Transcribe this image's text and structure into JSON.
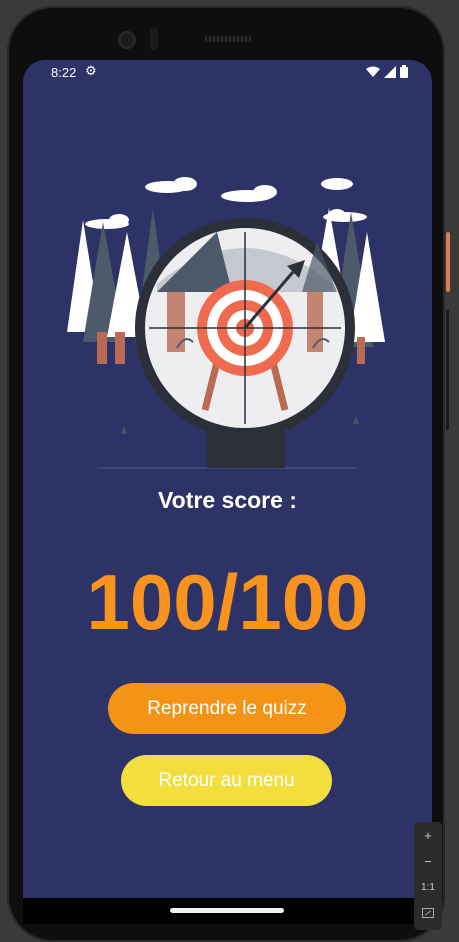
{
  "status_bar": {
    "time": "8:22"
  },
  "result": {
    "label": "Votre score :",
    "score": "100/100"
  },
  "buttons": {
    "restart": "Reprendre le quizz",
    "menu": "Retour au menu"
  },
  "zoom_controls": {
    "zoom_in": "+",
    "zoom_out": "−",
    "actual_size": "1:1"
  },
  "colors": {
    "background": "#2d3366",
    "score": "#f7931e",
    "restart_button": "#f39416",
    "menu_button": "#f2df3d"
  },
  "icons": [
    "gear-icon",
    "wifi-icon",
    "signal-icon",
    "battery-icon",
    "fit-screen-icon"
  ]
}
